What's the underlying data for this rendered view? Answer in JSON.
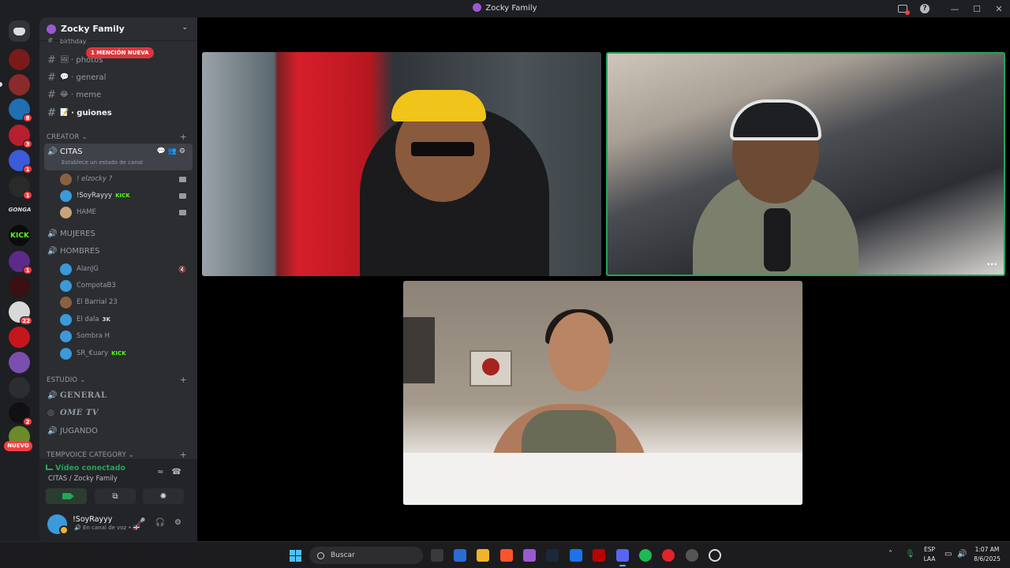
{
  "window": {
    "title": "Zocky Family"
  },
  "server": {
    "name": "Zocky Family"
  },
  "channels": {
    "top_partial": "birthday",
    "mention_pill": "1 MENCIÓN NUEVA",
    "items": [
      {
        "emoji": "🖼",
        "label": "· photos"
      },
      {
        "emoji": "💬",
        "label": "· general"
      },
      {
        "emoji": "😂",
        "label": "· meme"
      },
      {
        "emoji": "📝",
        "label": "· guiones"
      }
    ]
  },
  "categories": {
    "creator": "CREATOR",
    "estudio": "ESTUDIO",
    "tempvoice": "TEMPVOICE CATEGORY"
  },
  "voice_channels": {
    "citas": {
      "name": "CITAS",
      "status": "Establece un estado de canal"
    },
    "mujeres": "MUJERES",
    "hombres": "HOMBRES",
    "general": "GENERAL",
    "ome_tv": "OME TV",
    "jugando": "JUGANDO"
  },
  "citas_members": [
    {
      "name": "! elzocky ?"
    },
    {
      "name": "!SoyRayyy",
      "badge": "KICK"
    },
    {
      "name": "HAME"
    }
  ],
  "hombres_members": [
    {
      "name": "AlanJG"
    },
    {
      "name": "CompotaB3"
    },
    {
      "name": "El Barrial 23"
    },
    {
      "name": "El dala",
      "badge": "3K"
    },
    {
      "name": "Sombra H"
    },
    {
      "name": "SR_€uary",
      "badge": "KICK"
    }
  ],
  "rail": {
    "kick": "KICK",
    "gonga": "GONGA",
    "nuevo": "NUEVO",
    "badges": [
      "8",
      "3",
      "1",
      "1",
      "1",
      "22",
      "2"
    ]
  },
  "voice_panel": {
    "status": "Vídeo conectado",
    "location": "CITAS / Zocky Family"
  },
  "user": {
    "name": "!SoyRayyy",
    "status": "En canal de voz"
  },
  "taskbar": {
    "search_placeholder": "Buscar",
    "lang_top": "ESP",
    "lang_bottom": "LAA",
    "time": "1:07 AM",
    "date": "8/6/2025"
  },
  "colors": {
    "accent_green": "#23a55a",
    "mention_red": "#da373c",
    "kick_green": "#53fc18"
  }
}
